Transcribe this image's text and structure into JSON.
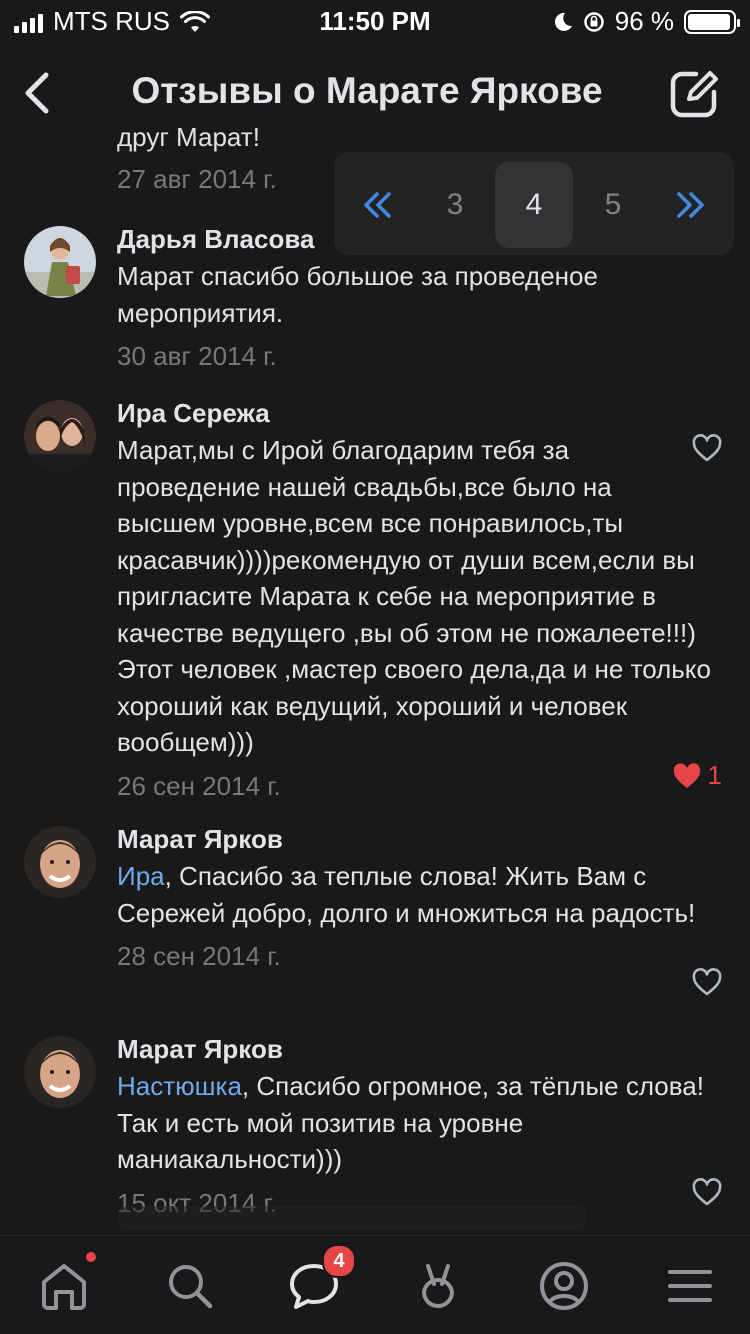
{
  "status_bar": {
    "carrier": "MTS RUS",
    "time": "11:50 PM",
    "battery_percent": "96 %",
    "battery_level": 0.96
  },
  "header": {
    "title": "Отзывы о Марате Яркове"
  },
  "feed": {
    "partial_text": "друг Марат!",
    "first_date": "27 авг 2014 г.",
    "comments": [
      {
        "author": "Дарья Власова",
        "text": "Марат спасибо большое за проведеное мероприятия.",
        "date": "30 авг 2014 г.",
        "likes": "",
        "liked": false
      },
      {
        "author": "Ира Сережа",
        "text": "Марат,мы с Ирой благодарим тебя за проведение нашей свадьбы,все было на высшем уровне,всем все понравилось,ты красавчик))))рекомендую от души всем,если вы пригласите Марата к себе на мероприятие в качестве ведущего ,вы об этом не пожалеете!!!) Этот человек ,мастер своего дела,да и не только хороший как ведущий, хороший и человек вообщем)))",
        "date": "26 сен 2014 г.",
        "likes": "1",
        "liked": true
      },
      {
        "author": "Марат Ярков",
        "mention": "Ира",
        "text": ", Спасибо за теплые слова! Жить Вам с Сережей добро, долго и множиться на радость!",
        "date": "28 сен 2014 г.",
        "likes": "",
        "liked": false
      },
      {
        "author": "Марат Ярков",
        "mention": "Настюшка",
        "text": ", Спасибо огромное, за тёплые слова! Так и есть мой позитив на уровне маниакальности)))",
        "date": "15 окт 2014 г.",
        "likes": "",
        "liked": false
      }
    ]
  },
  "pagination": {
    "prev_label": "«",
    "pages": [
      "3",
      "4",
      "5"
    ],
    "current": "4",
    "next_label": "»"
  },
  "tabbar": {
    "tabs": [
      "home-icon",
      "search-icon",
      "messages-icon",
      "clips-icon",
      "profile-icon",
      "menu-icon"
    ],
    "messages_badge": "4"
  },
  "colors": {
    "background": "#19191a",
    "accent": "#3f8ae0",
    "mention": "#71aaeb",
    "like_active": "#e64646"
  }
}
